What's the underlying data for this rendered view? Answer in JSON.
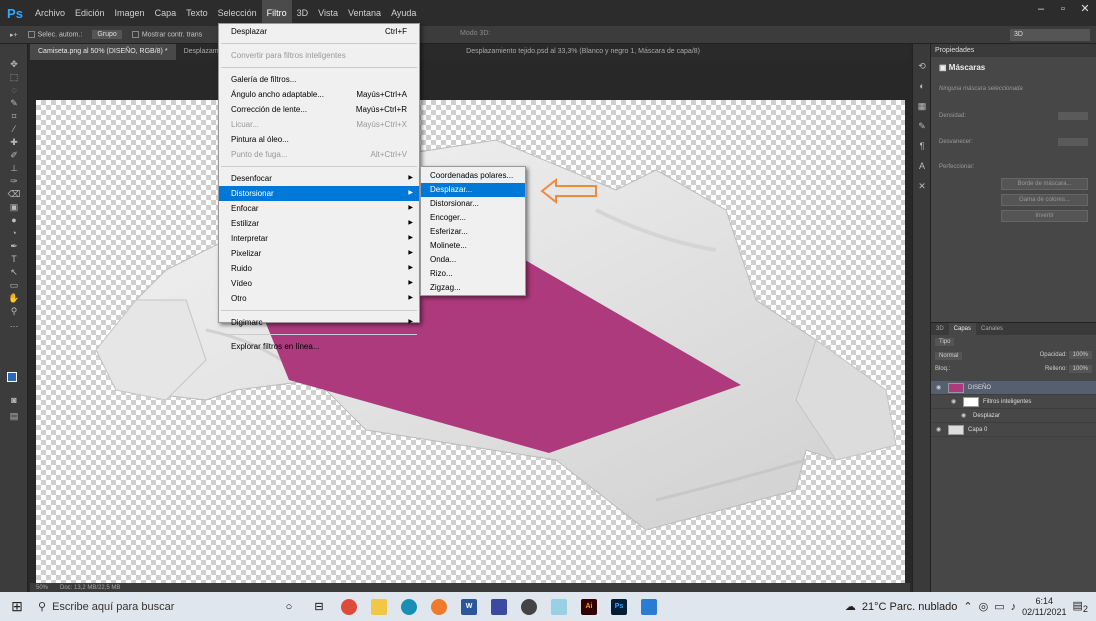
{
  "app": {
    "logo": "Ps",
    "menus": [
      "Archivo",
      "Edición",
      "Imagen",
      "Capa",
      "Texto",
      "Selección",
      "Filtro",
      "3D",
      "Vista",
      "Ventana",
      "Ayuda"
    ],
    "active_menu": "Filtro",
    "window_controls": [
      "–",
      "▫",
      "✕"
    ]
  },
  "options_bar": {
    "auto_select_label": "Selec. autom.:",
    "group_select": "Grupo",
    "show_transform_label": "Mostrar contr. trans",
    "mode_3d_label": "Modo 3D:",
    "workspace": "3D"
  },
  "tabs": [
    "Camiseta.png al 50% (DISEÑO, RGB/8) *",
    "Desplazami",
    "Desplazamiento tejido.psd al 33,3% (Blanco y negro 1, Máscara de capa/8)"
  ],
  "filter_menu": {
    "items": [
      {
        "label": "Desplazar",
        "shortcut": "Ctrl+F",
        "state": "normal"
      },
      {
        "sep": true
      },
      {
        "label": "Convertir para filtros inteligentes",
        "shortcut": "",
        "state": "disabled"
      },
      {
        "sep": true
      },
      {
        "label": "Galería de filtros...",
        "shortcut": "",
        "state": "normal"
      },
      {
        "label": "Ángulo ancho adaptable...",
        "shortcut": "Mayús+Ctrl+A",
        "state": "normal"
      },
      {
        "label": "Corrección de lente...",
        "shortcut": "Mayús+Ctrl+R",
        "state": "normal"
      },
      {
        "label": "Licuar...",
        "shortcut": "Mayús+Ctrl+X",
        "state": "disabled"
      },
      {
        "label": "Pintura al óleo...",
        "shortcut": "",
        "state": "normal"
      },
      {
        "label": "Punto de fuga...",
        "shortcut": "Alt+Ctrl+V",
        "state": "disabled"
      },
      {
        "sep": true
      },
      {
        "label": "Desenfocar",
        "shortcut": "",
        "state": "submenu"
      },
      {
        "label": "Distorsionar",
        "shortcut": "",
        "state": "highlighted"
      },
      {
        "label": "Enfocar",
        "shortcut": "",
        "state": "submenu"
      },
      {
        "label": "Estilizar",
        "shortcut": "",
        "state": "submenu"
      },
      {
        "label": "Interpretar",
        "shortcut": "",
        "state": "submenu"
      },
      {
        "label": "Pixelizar",
        "shortcut": "",
        "state": "submenu"
      },
      {
        "label": "Ruido",
        "shortcut": "",
        "state": "submenu"
      },
      {
        "label": "Vídeo",
        "shortcut": "",
        "state": "submenu"
      },
      {
        "label": "Otro",
        "shortcut": "",
        "state": "submenu"
      },
      {
        "sep": true
      },
      {
        "label": "Digimarc",
        "shortcut": "",
        "state": "submenu"
      },
      {
        "sep": true
      },
      {
        "label": "Explorar filtros en línea...",
        "shortcut": "",
        "state": "normal"
      }
    ]
  },
  "distort_submenu": {
    "items": [
      "Coordenadas polares...",
      "Desplazar...",
      "Distorsionar...",
      "Encoger...",
      "Esferizar...",
      "Molinete...",
      "Onda...",
      "Rizo...",
      "Zigzag..."
    ],
    "highlighted": "Desplazar..."
  },
  "properties_panel": {
    "tab": "Propiedades",
    "header": "Máscaras",
    "no_mask": "Ninguna máscara seleccionada",
    "density_label": "Densidad:",
    "feather_label": "Desvanecer:",
    "refine_label": "Perfeccionar:",
    "buttons": [
      "Borde de máscara...",
      "Gama de colores...",
      "Invertir"
    ]
  },
  "layers_panel": {
    "tabs": [
      "3D",
      "Capas",
      "Canales"
    ],
    "active_tab": "Capas",
    "kind_filter": "Tipo",
    "blend_mode": "Normal",
    "opacity_label": "Opacidad:",
    "opacity": "100%",
    "lock_label": "Bloq.:",
    "fill_label": "Relleno:",
    "fill": "100%",
    "layers": [
      {
        "name": "DISEÑO",
        "selected": true
      },
      {
        "name": "Filtros inteligentes",
        "selected": false
      },
      {
        "name": "Desplazar",
        "selected": false
      },
      {
        "name": "Capa 0",
        "selected": false
      }
    ]
  },
  "status_bar": {
    "zoom": "50%",
    "doc_info": "Doc: 13,2 MB/22,5 MB"
  },
  "taskbar": {
    "search_placeholder": "Escribe aquí para buscar",
    "weather": "21°C Parc. nublado",
    "time": "6:14",
    "date": "02/11/2021",
    "notification_count": "2",
    "apps": [
      {
        "name": "word",
        "label": "W",
        "color": "#2b579a"
      },
      {
        "name": "illustrator",
        "label": "Ai",
        "color": "#330000"
      },
      {
        "name": "photoshop",
        "label": "Ps",
        "color": "#001e36"
      }
    ]
  },
  "colors": {
    "accent_menu_highlight": "#0078d7",
    "canvas_design_fill": "#ad3a7c",
    "annotation_arrow": "#f08a3c"
  }
}
